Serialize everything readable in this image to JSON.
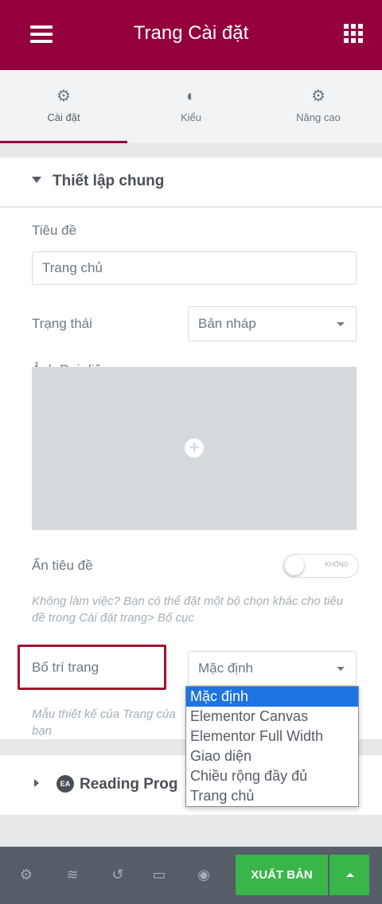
{
  "header": {
    "title": "Trang Cài đặt"
  },
  "tabs": [
    {
      "label": "Cài đặt",
      "icon": "gear-icon",
      "active": true
    },
    {
      "label": "Kiểu",
      "icon": "contrast-icon",
      "active": false
    },
    {
      "label": "Nâng cao",
      "icon": "gear-icon",
      "active": false
    }
  ],
  "section": {
    "title": "Thiết lập chung"
  },
  "fields": {
    "title_label": "Tiêu đề",
    "title_value": "Trang chủ",
    "status_label": "Trạng thái",
    "status_value": "Bản nháp",
    "featured_label": "Ảnh Đại diện",
    "hide_title_label": "Ẩn tiêu đề",
    "toggle_text": "KHÔNG",
    "hide_title_note": "Không làm việc? Bạn có thể đặt một bộ chọn khác cho tiêu đề trong Cài đặt trang> Bố cục",
    "layout_label": "Bố trí trang",
    "layout_value": "Mặc định",
    "layout_note": "Mẫu thiết kế của Trang của bạn"
  },
  "layout_options": [
    "Mặc định",
    "Elementor Canvas",
    "Elementor Full Width",
    "Giao diện",
    "Chiều rộng đầy đủ",
    "Trang chủ"
  ],
  "section2": {
    "badge": "EA",
    "title": "Reading Prog"
  },
  "footer": {
    "publish_label": "XUẤT BẢN"
  },
  "colors": {
    "brand": "#93003c",
    "publish": "#39b54a",
    "highlight": "#a0142a",
    "selected": "#1e74e0"
  }
}
